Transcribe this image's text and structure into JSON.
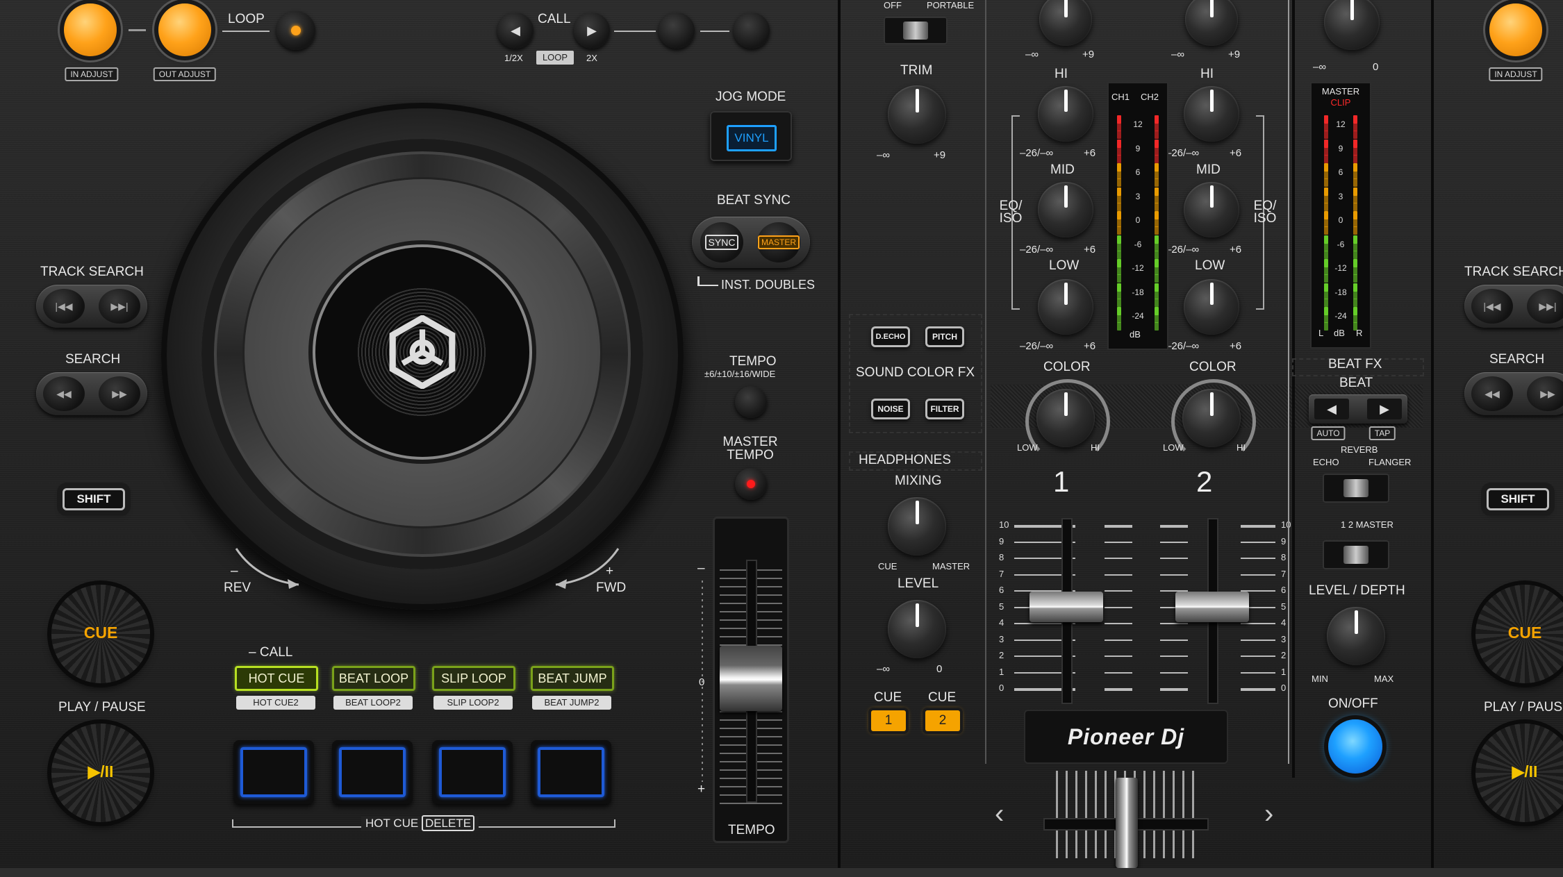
{
  "left_deck": {
    "loop": {
      "label": "LOOP",
      "in_adjust": "IN ADJUST",
      "out_adjust": "OUT ADJUST"
    },
    "call": {
      "label": "CALL",
      "half": "1/2X",
      "loop": "LOOP",
      "double": "2X"
    },
    "jog_mode": {
      "label": "JOG MODE",
      "vinyl": "VINYL"
    },
    "beat_sync": {
      "label": "BEAT SYNC",
      "sync": "SYNC",
      "master": "MASTER",
      "inst_doubles": "INST. DOUBLES"
    },
    "tempo_range": {
      "label": "TEMPO",
      "ranges": "±6/±10/±16/WIDE"
    },
    "master_tempo": {
      "label": "MASTER TEMPO"
    },
    "track_search": "TRACK SEARCH",
    "search": "SEARCH",
    "shift": "SHIFT",
    "cue": "CUE",
    "play_pause": {
      "label": "PLAY / PAUSE",
      "icon": "▶/II"
    },
    "jog": {
      "rev": "REV",
      "rev_sign": "–",
      "fwd": "FWD",
      "fwd_sign": "+"
    },
    "pad_modes": {
      "call": "– CALL",
      "modes": [
        "HOT CUE",
        "BEAT LOOP",
        "SLIP LOOP",
        "BEAT JUMP"
      ],
      "shift_modes": [
        "HOT CUE2",
        "BEAT LOOP2",
        "SLIP LOOP2",
        "BEAT JUMP2"
      ]
    },
    "hot_cue_delete": {
      "label": "HOT CUE",
      "delete": "DELETE"
    },
    "tempo_fader": {
      "label": "TEMPO",
      "minus": "–",
      "zero": "0",
      "plus": "+"
    }
  },
  "mixer": {
    "mic": {
      "off": "OFF",
      "portable": "PORTABLE",
      "trim": "TRIM",
      "min": "–∞",
      "max": "+9"
    },
    "sound_color_fx": {
      "label": "SOUND COLOR FX",
      "buttons": [
        "D.ECHO",
        "PITCH",
        "NOISE",
        "FILTER"
      ]
    },
    "headphones": {
      "label": "HEADPHONES",
      "mixing": "MIXING",
      "cue": "CUE",
      "master": "MASTER",
      "level": "LEVEL",
      "min": "–∞",
      "max": "0"
    },
    "cue_buttons": [
      {
        "label": "CUE",
        "num": "1"
      },
      {
        "label": "CUE",
        "num": "2"
      }
    ],
    "channels": [
      {
        "num": "1",
        "trim_min": "–∞",
        "trim_max": "+9",
        "hi": "HI",
        "mid": "MID",
        "low": "LOW",
        "eq_min": "–26/–∞",
        "eq_max": "+6",
        "color": "COLOR",
        "color_low": "LOW",
        "color_hi": "HI"
      },
      {
        "num": "2",
        "trim_min": "–∞",
        "trim_max": "+9",
        "hi": "HI",
        "mid": "MID",
        "low": "LOW",
        "eq_min": "–26/–∞",
        "eq_max": "+6",
        "color": "COLOR",
        "color_low": "LOW",
        "color_hi": "HI"
      }
    ],
    "eq_iso": "EQ/ ISO",
    "ch_meter": {
      "ch1": "CH1",
      "ch2": "CH2",
      "scale": [
        "12",
        "9",
        "6",
        "3",
        "0",
        "-6",
        "-12",
        "-18",
        "-24"
      ],
      "unit": "dB"
    },
    "fader_scale": [
      "10",
      "9",
      "8",
      "7",
      "6",
      "5",
      "4",
      "3",
      "2",
      "1",
      "0"
    ],
    "logo": "Pioneer Dj",
    "crossfader": {
      "left": "‹",
      "right": "›"
    }
  },
  "master": {
    "level": {
      "min": "–∞",
      "max": "0"
    },
    "meter": {
      "label": "MASTER",
      "clip": "CLIP",
      "scale": [
        "12",
        "9",
        "6",
        "3",
        "0",
        "-6",
        "-12",
        "-18",
        "-24"
      ],
      "l": "L",
      "unit": "dB",
      "r": "R"
    },
    "beat_fx": {
      "label": "BEAT FX",
      "beat": "BEAT",
      "auto": "AUTO",
      "tap": "TAP",
      "reverb": "REVERB",
      "echo": "ECHO",
      "flanger": "FLANGER",
      "ch_select": "1  2  MASTER",
      "level_depth": "LEVEL / DEPTH",
      "min": "MIN",
      "max": "MAX",
      "on_off": "ON/OFF"
    }
  },
  "right_deck": {
    "in_adjust": "IN ADJUST",
    "track_search": "TRACK SEARCH",
    "search": "SEARCH",
    "shift": "SHIFT",
    "cue": "CUE",
    "play_pause": "PLAY / PAUSE"
  },
  "colors": {
    "orange": "#ffa21a",
    "blue": "#1e5ad6",
    "green": "#b7e022",
    "cue_orange": "#f5a300",
    "clip_red": "#ff2a2a",
    "vinyl_blue": "#1ea0ff"
  }
}
